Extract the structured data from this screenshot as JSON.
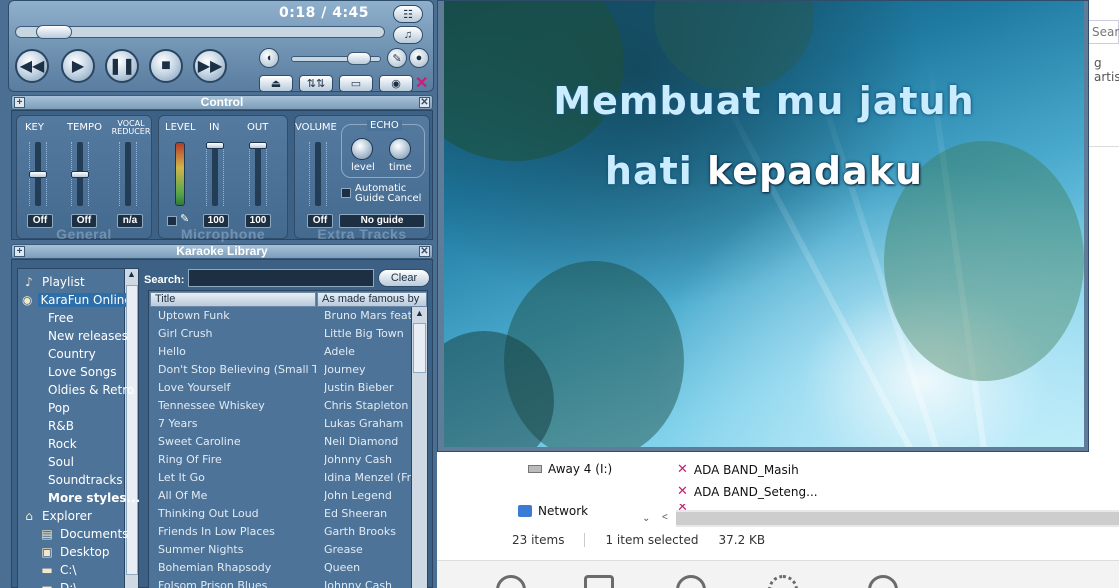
{
  "player": {
    "time_elapsed": "0:18",
    "time_total": "4:45",
    "seek_fraction": 0.063,
    "volume_fraction": 0.85,
    "icons": {
      "rewind": "rewind-icon",
      "play": "play-icon",
      "pause": "pause-icon",
      "stop": "stop-icon",
      "forward": "fast-forward-icon",
      "eject": "eject-icon",
      "mixer": "mixer-icon",
      "folder": "folder-icon",
      "globe": "globe-icon",
      "speaker": "speaker-icon",
      "logo": "karafun-logo-icon"
    }
  },
  "control": {
    "title": "Control",
    "general": {
      "group_label": "General",
      "key_label": "KEY",
      "tempo_label": "TEMPO",
      "vocal_reducer_label": "VOCAL REDUCER",
      "key_value": "Off",
      "tempo_value": "Off",
      "vocal_reducer_value": "n/a"
    },
    "microphone": {
      "group_label": "Microphone",
      "level_label": "LEVEL",
      "in_label": "IN",
      "out_label": "OUT",
      "in_value": "100",
      "out_value": "100"
    },
    "extra_tracks": {
      "group_label": "Extra Tracks",
      "volume_label": "VOLUME",
      "echo_label": "ECHO",
      "level_knob_label": "level",
      "time_knob_label": "time",
      "auto_guide_label": "Automatic Guide Cancel",
      "volume_value": "Off",
      "guide_value": "No guide"
    }
  },
  "library": {
    "title": "Karaoke Library",
    "search_label": "Search:",
    "search_value": "",
    "clear_label": "Clear",
    "col_title": "Title",
    "col_artist": "As made famous by",
    "tree": [
      {
        "label": "Playlist",
        "icon": "playlist-icon",
        "level": 0
      },
      {
        "label": "KaraFun Online",
        "icon": "globe-icon",
        "level": 0,
        "selected": true
      },
      {
        "label": "Free",
        "icon": "",
        "level": 1
      },
      {
        "label": "New releases",
        "icon": "",
        "level": 1
      },
      {
        "label": "Country",
        "icon": "",
        "level": 1
      },
      {
        "label": "Love Songs",
        "icon": "",
        "level": 1
      },
      {
        "label": "Oldies & Retro",
        "icon": "",
        "level": 1
      },
      {
        "label": "Pop",
        "icon": "",
        "level": 1
      },
      {
        "label": "R&B",
        "icon": "",
        "level": 1
      },
      {
        "label": "Rock",
        "icon": "",
        "level": 1
      },
      {
        "label": "Soul",
        "icon": "",
        "level": 1
      },
      {
        "label": "Soundtracks",
        "icon": "",
        "level": 1
      },
      {
        "label": "More styles...",
        "icon": "",
        "level": 1,
        "bold": true
      },
      {
        "label": "Explorer",
        "icon": "explorer-icon",
        "level": 0
      },
      {
        "label": "Documents",
        "icon": "folder-icon",
        "level": 1
      },
      {
        "label": "Desktop",
        "icon": "desktop-icon",
        "level": 1
      },
      {
        "label": "C:\\",
        "icon": "drive-icon",
        "level": 1
      },
      {
        "label": "D:\\",
        "icon": "drive-icon",
        "level": 1
      }
    ],
    "songs": [
      {
        "title": "Uptown Funk",
        "artist": "Bruno Mars feat. M"
      },
      {
        "title": "Girl Crush",
        "artist": "Little Big Town"
      },
      {
        "title": "Hello",
        "artist": "Adele"
      },
      {
        "title": "Don't Stop Believing (Small To...",
        "artist": "Journey"
      },
      {
        "title": "Love Yourself",
        "artist": "Justin Bieber"
      },
      {
        "title": "Tennessee Whiskey",
        "artist": "Chris Stapleton"
      },
      {
        "title": "7 Years",
        "artist": "Lukas Graham"
      },
      {
        "title": "Sweet Caroline",
        "artist": "Neil Diamond"
      },
      {
        "title": "Ring Of Fire",
        "artist": "Johnny Cash"
      },
      {
        "title": "Let It Go",
        "artist": "Idina Menzel (Froz"
      },
      {
        "title": "All Of Me",
        "artist": "John Legend"
      },
      {
        "title": "Thinking Out Loud",
        "artist": "Ed Sheeran"
      },
      {
        "title": "Friends In Low Places",
        "artist": "Garth Brooks"
      },
      {
        "title": "Summer Nights",
        "artist": "Grease"
      },
      {
        "title": "Bohemian Rhapsody",
        "artist": "Queen"
      },
      {
        "title": "Folsom Prison Blues",
        "artist": "Johnny Cash"
      }
    ]
  },
  "lyrics": {
    "line1": "Membuat mu jatuh",
    "line2_sung": "hati ",
    "line2_unsung": "kepadaku"
  },
  "explorer": {
    "search_placeholder": "Searc",
    "artist_fragment": "g artist",
    "nav_away4": "Away 4 (I:)",
    "nav_network": "Network",
    "files": [
      "ADA BAND_Masih",
      "ADA BAND_Seteng..."
    ],
    "status_items": "23 items",
    "status_selected": "1 item selected",
    "status_size": "37.2 KB"
  }
}
